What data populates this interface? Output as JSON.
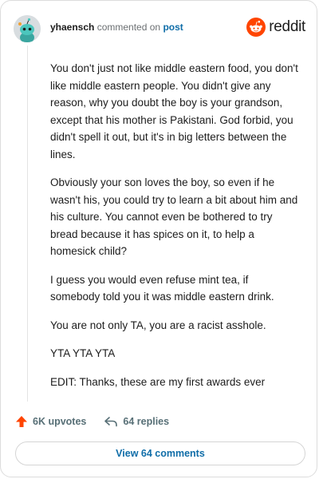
{
  "header": {
    "username": "yhaensch",
    "action_text": "commented on",
    "post_link": "post",
    "brand_name": "reddit",
    "avatar_icon": "snoo-avatar-icon",
    "brand_icon": "reddit-logo-icon",
    "brand_color": "#ff4500"
  },
  "comment": {
    "paragraphs": [
      "You don't just not like middle eastern food, you don't like middle eastern people. You didn't give any reason, why you doubt the boy is your grandson, except that his mother is Pakistani. God forbid, you didn't spell it out, but it's in big letters between the lines.",
      "Obviously your son loves the boy, so even if he wasn't his, you could try to learn a bit about him and his culture. You cannot even be bothered to try bread because it has spices on it, to help a homesick child?",
      "I guess you would even refuse mint tea, if somebody told you it was middle eastern drink.",
      "You are not only TA, you are a racist asshole.",
      "YTA YTA YTA",
      "EDIT: Thanks, these are my first awards ever"
    ]
  },
  "actions": {
    "upvotes_label": "6K upvotes",
    "replies_label": "64 replies",
    "upvote_icon": "upvote-arrow-icon",
    "reply_icon": "reply-arrow-icon",
    "upvote_color": "#ff4500"
  },
  "footer": {
    "view_comments_label": "View 64 comments"
  }
}
